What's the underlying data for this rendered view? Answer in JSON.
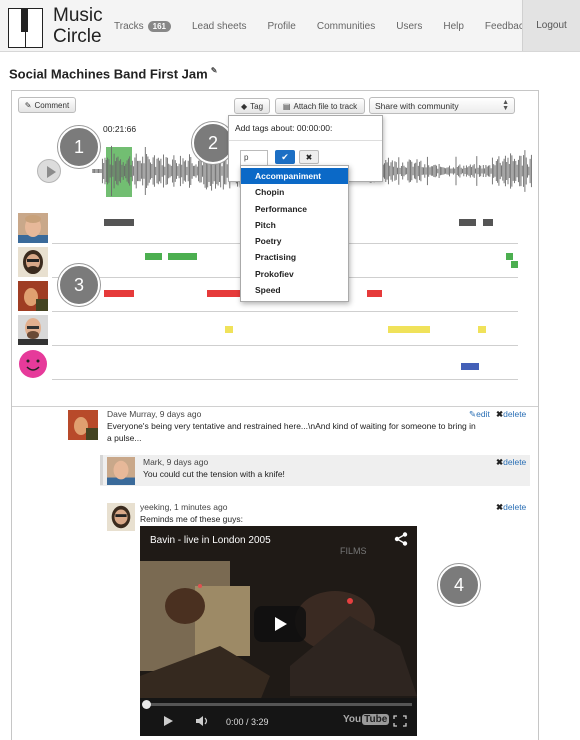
{
  "app": {
    "logo_text_1": "Music",
    "logo_text_2": "Circle"
  },
  "nav": {
    "tracks_label": "Tracks",
    "tracks_count": "161",
    "lead_sheets": "Lead sheets",
    "profile": "Profile",
    "communities": "Communities",
    "users": "Users",
    "help": "Help",
    "feedback": "Feedback",
    "logout": "Logout"
  },
  "page": {
    "title": "Social Machines Band First Jam"
  },
  "toolbar": {
    "comment_label": "Comment",
    "tag_label": "Tag",
    "attach_label": "Attach file to track",
    "share_value": "Share with community"
  },
  "player": {
    "time": "00:21:66"
  },
  "tagger": {
    "title": "Add tags about: 00:00:00:",
    "input_value": "p",
    "options": [
      "Accompaniment",
      "Chopin",
      "Performance",
      "Pitch",
      "Poetry",
      "Practising",
      "Prokofiev",
      "Speed"
    ],
    "active_index": 0
  },
  "callouts": [
    "1",
    "2",
    "3",
    "4"
  ],
  "colors": {
    "selection": "#59b359",
    "track_dark": "#555555",
    "track_green": "#4caf50",
    "track_red": "#e63a3a",
    "track_yellow": "#f0e25a",
    "track_blue": "#4460b8",
    "link": "#2a6fb5",
    "dropdown_active": "#0b69c7"
  },
  "comments": [
    {
      "meta": "Dave Murray, 9 days ago",
      "line1": "Everyone's being very tentative and restrained here...\\nAnd kind of waiting for someone to bring in",
      "line2": "a pulse...",
      "edit": "edit",
      "delete": "delete"
    },
    {
      "meta": "Mark, 9 days ago",
      "line1": "You could cut the tension with a knife!",
      "delete": "delete"
    },
    {
      "meta": "yeeking, 1 minutes ago",
      "line1": "Reminds me of these guys:",
      "delete": "delete"
    }
  ],
  "video": {
    "title": "Bavin - live in London 2005",
    "watermark": "FILMS",
    "time": "0:00 / 3:29",
    "logo_you": "You",
    "logo_tube": "Tube",
    "progress": 0
  }
}
